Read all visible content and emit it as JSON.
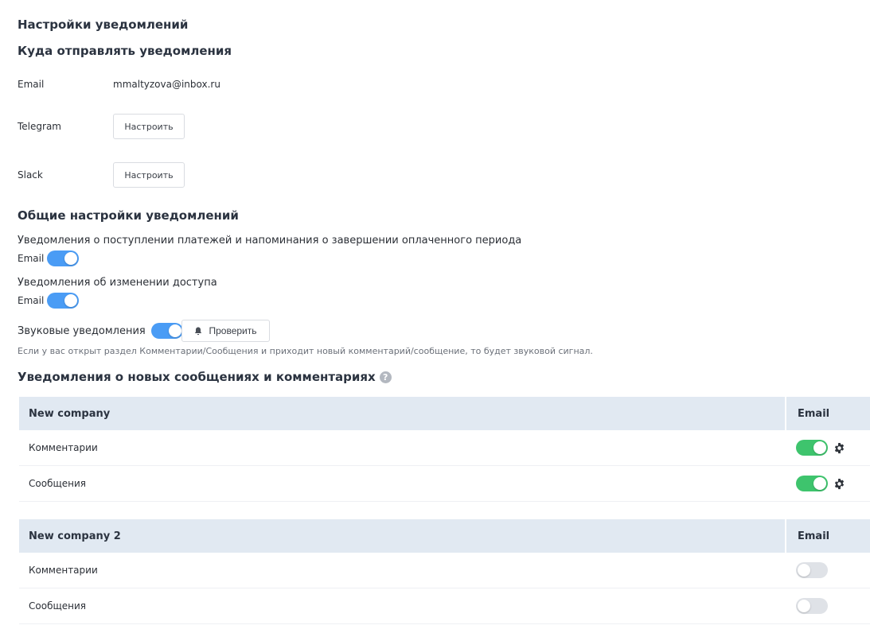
{
  "page_title": "Настройки уведомлений",
  "destinations": {
    "title": "Куда отправлять уведомления",
    "email_label": "Email",
    "email_value": "mmaltyzova@inbox.ru",
    "telegram_label": "Telegram",
    "telegram_button": "Настроить",
    "slack_label": "Slack",
    "slack_button": "Настроить"
  },
  "general": {
    "title": "Общие настройки уведомлений",
    "payments_text": "Уведомления о поступлении платежей и напоминания о завершении оплаченного периода",
    "payments_channel": "Email",
    "payments_enabled": true,
    "access_text": "Уведомления об изменении доступа",
    "access_channel": "Email",
    "access_enabled": true,
    "sound_label": "Звуковые уведомления",
    "sound_enabled": true,
    "check_button": "Проверить",
    "sound_note": "Если у вас открыт раздел Комментарии/Сообщения и приходит новый комментарий/сообщение, то будет звуковой сигнал."
  },
  "messages": {
    "title": "Уведомления о новых сообщениях и комментариях",
    "help_icon": "?",
    "companies": [
      {
        "name": "New company",
        "column": "Email",
        "rows": [
          {
            "label": "Комментарии",
            "enabled": true
          },
          {
            "label": "Сообщения",
            "enabled": true
          }
        ]
      },
      {
        "name": "New company 2",
        "column": "Email",
        "rows": [
          {
            "label": "Комментарии",
            "enabled": false
          },
          {
            "label": "Сообщения",
            "enabled": false
          }
        ]
      }
    ]
  },
  "colors": {
    "toggle_blue": "#4a9cf5",
    "toggle_green": "#3ec46d",
    "toggle_off": "#dfe2e7",
    "table_header": "#e1e9f2"
  },
  "icons": {
    "bell": "bell-icon",
    "gear": "gear-icon",
    "help": "question-circle-icon"
  }
}
